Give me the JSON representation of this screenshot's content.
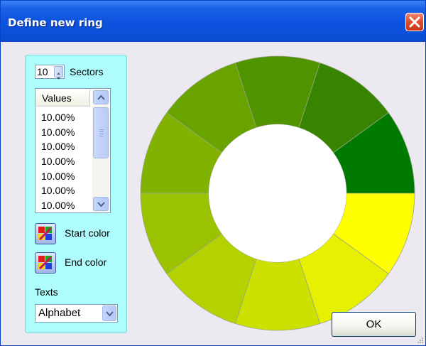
{
  "window": {
    "title": "Define new ring"
  },
  "sectors": {
    "value": "10",
    "label": "Sectors"
  },
  "values_list": {
    "header": "Values",
    "rows": [
      "10.00%",
      "10.00%",
      "10.00%",
      "10.00%",
      "10.00%",
      "10.00%",
      "10.00%"
    ]
  },
  "start_color": {
    "label": "Start color"
  },
  "end_color": {
    "label": "End color"
  },
  "texts": {
    "label": "Texts",
    "selected": "Alphabet"
  },
  "ok_button": {
    "label": "OK"
  },
  "ring": {
    "sector_colors": [
      "#ffff00",
      "#e6f000",
      "#cde100",
      "#b4d100",
      "#9bc200",
      "#82b200",
      "#69a300",
      "#509400",
      "#378400",
      "#007a00"
    ],
    "sector_percent": [
      10,
      10,
      10,
      10,
      10,
      10,
      10,
      10,
      10,
      10
    ]
  },
  "colors": {
    "panel_bg": "#aefcfc",
    "title_bar": "#0d53df",
    "window_bg": "#ece9f0"
  }
}
